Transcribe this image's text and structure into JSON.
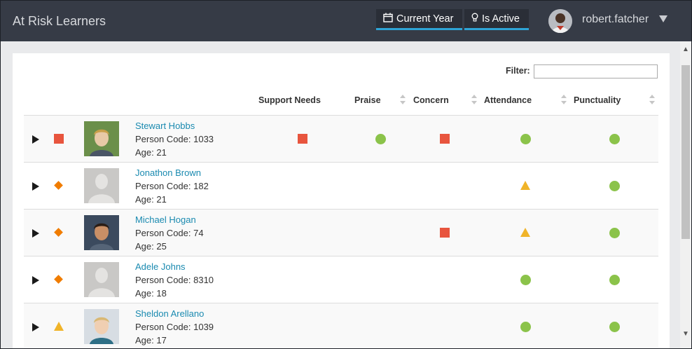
{
  "header": {
    "app_title": "At Risk Learners",
    "year_filter_label": "Current Year",
    "active_filter_label": "Is Active",
    "user_name": "robert.fatcher"
  },
  "filter": {
    "label": "Filter:",
    "value": ""
  },
  "columns": {
    "support": "Support Needs",
    "praise": "Praise",
    "concern": "Concern",
    "attendance": "Attendance",
    "punctuality": "Punctuality"
  },
  "colors": {
    "red": "#e8553e",
    "green": "#8bc34a",
    "amber": "#f0b429",
    "orange": "#f07c00",
    "link": "#1a8ab0",
    "accent": "#2ea4d6"
  },
  "learners": [
    {
      "name": "Stewart Hobbs",
      "code": "Person Code: 1033",
      "age": "Age: 21",
      "risk": "red-square",
      "photo": "photo",
      "support": "red-square",
      "praise": "green-circle",
      "concern": "red-square",
      "attendance": "green-circle",
      "punctuality": "green-circle"
    },
    {
      "name": "Jonathon Brown",
      "code": "Person Code: 182",
      "age": "Age: 21",
      "risk": "orange-diamond",
      "photo": "placeholder",
      "support": "",
      "praise": "",
      "concern": "",
      "attendance": "amber-triangle",
      "punctuality": "green-circle"
    },
    {
      "name": "Michael Hogan",
      "code": "Person Code: 74",
      "age": "Age: 25",
      "risk": "orange-diamond",
      "photo": "photo",
      "support": "",
      "praise": "",
      "concern": "red-square",
      "attendance": "amber-triangle",
      "punctuality": "green-circle"
    },
    {
      "name": "Adele Johns",
      "code": "Person Code: 8310",
      "age": "Age: 18",
      "risk": "orange-diamond",
      "photo": "placeholder",
      "support": "",
      "praise": "",
      "concern": "",
      "attendance": "green-circle",
      "punctuality": "green-circle"
    },
    {
      "name": "Sheldon Arellano",
      "code": "Person Code: 1039",
      "age": "Age: 17",
      "risk": "amber-triangle",
      "photo": "photo",
      "support": "",
      "praise": "",
      "concern": "",
      "attendance": "green-circle",
      "punctuality": "green-circle"
    }
  ]
}
